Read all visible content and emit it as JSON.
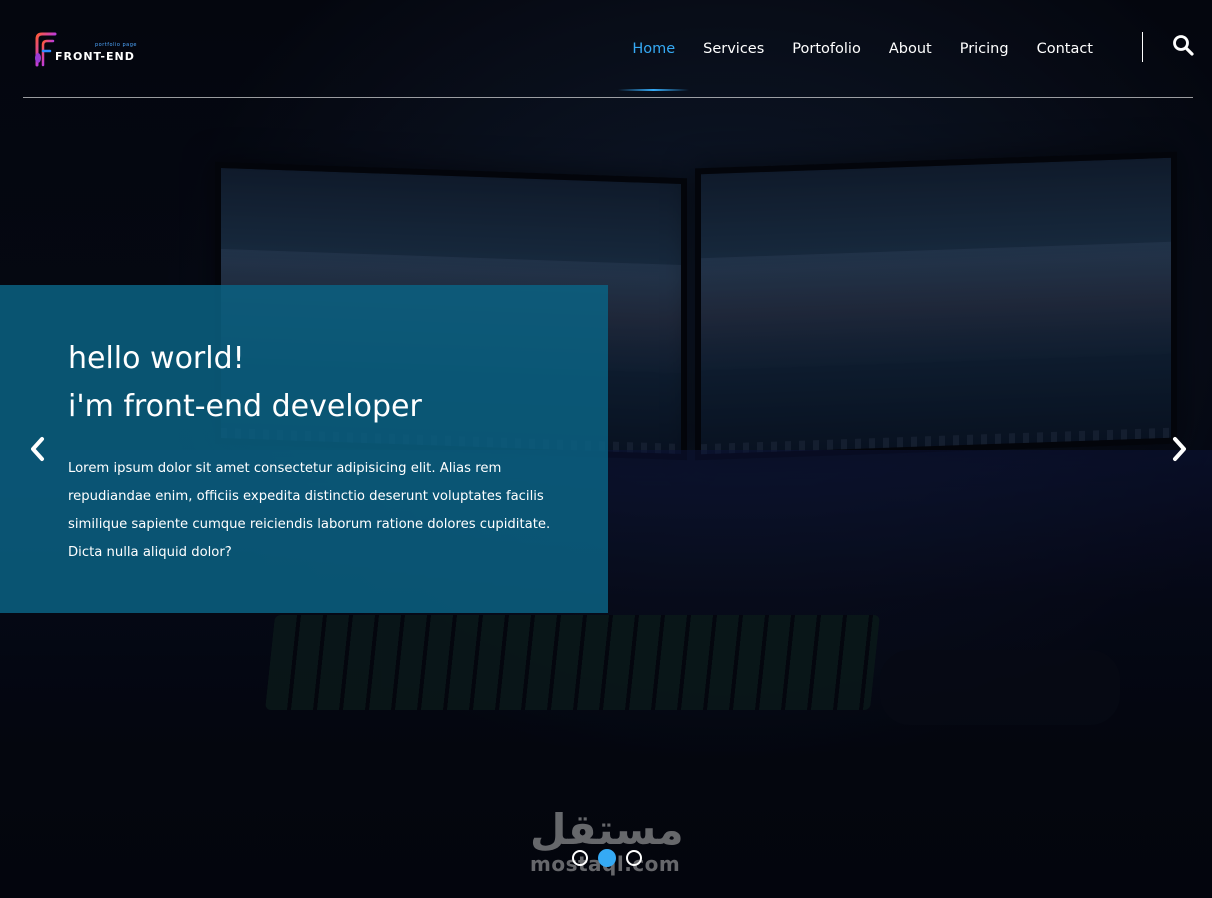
{
  "brand": {
    "logo_small_text": "portfolio page",
    "logo_text": "FRONT-END"
  },
  "nav": {
    "items": [
      {
        "label": "Home",
        "active": true
      },
      {
        "label": "Services",
        "active": false
      },
      {
        "label": "Portofolio",
        "active": false
      },
      {
        "label": "About",
        "active": false
      },
      {
        "label": "Pricing",
        "active": false
      },
      {
        "label": "Contact",
        "active": false
      }
    ],
    "search_icon": "search-icon"
  },
  "hero": {
    "title_line1": "hello world!",
    "title_line2": "i'm front-end developer",
    "description": "Lorem ipsum dolor sit amet consectetur adipisicing elit. Alias rem repudiandae enim, officiis expedita distinctio deserunt voluptates facilis similique sapiente cumque reiciendis laborum ratione dolores cupiditate. Dicta nulla aliquid dolor?",
    "prev_icon": "chevron-left-icon",
    "next_icon": "chevron-right-icon",
    "slides": 3,
    "active_slide": 2
  },
  "watermark": {
    "arabic": "مستقل",
    "latin": "mostaql.com"
  },
  "colors": {
    "accent": "#35aaf5",
    "caption_bg": "#0a6282",
    "text": "#ffffff"
  }
}
